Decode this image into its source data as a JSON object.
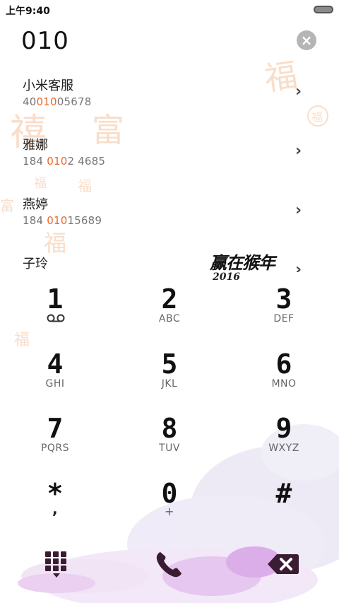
{
  "status_bar": {
    "time": "上午9:40"
  },
  "dialer": {
    "number": "010",
    "clear_glyph": "×"
  },
  "contacts": [
    {
      "name": "小米客服",
      "num_before": "40",
      "num_match": "010",
      "num_after": "05678"
    },
    {
      "name": "雅娜",
      "num_before": "184 ",
      "num_match": "010",
      "num_after": "2 4685"
    },
    {
      "name": "燕婷",
      "num_before": "184 ",
      "num_match": "010",
      "num_after": "15689"
    },
    {
      "name": "子玲",
      "num_before": "",
      "num_match": "",
      "num_after": ""
    }
  ],
  "banner": {
    "title": "赢在猴年",
    "year": "2016"
  },
  "keypad": {
    "keys": [
      {
        "digit": "1",
        "sub": ""
      },
      {
        "digit": "2",
        "sub": "ABC"
      },
      {
        "digit": "3",
        "sub": "DEF"
      },
      {
        "digit": "4",
        "sub": "GHI"
      },
      {
        "digit": "5",
        "sub": "JKL"
      },
      {
        "digit": "6",
        "sub": "MNO"
      },
      {
        "digit": "7",
        "sub": "PQRS"
      },
      {
        "digit": "8",
        "sub": "TUV"
      },
      {
        "digit": "9",
        "sub": "WXYZ"
      },
      {
        "digit": "*",
        "sub": ","
      },
      {
        "digit": "0",
        "sub": "+"
      },
      {
        "digit": "#",
        "sub": ""
      }
    ]
  },
  "icons": {
    "voicemail": "voicemail-icon",
    "dialpad": "dialpad-icon",
    "call": "phone-icon",
    "backspace": "backspace-icon",
    "chevron": "chevron-right-icon"
  },
  "colors": {
    "highlight": "#e8682a",
    "icon_dark": "#3a1c33",
    "deco_orange": "#f3b58a",
    "deco_purple": "#c99be0"
  }
}
